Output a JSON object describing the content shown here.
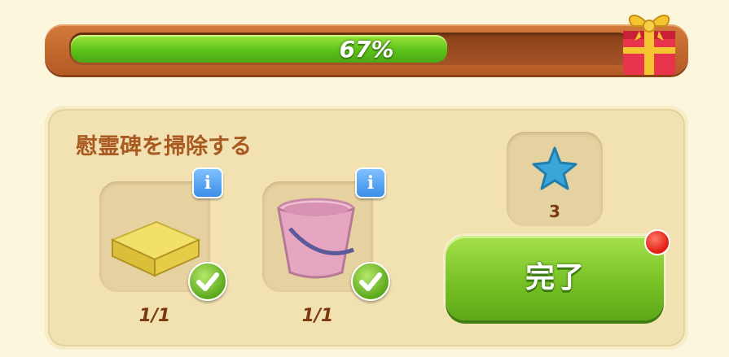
{
  "progress": {
    "percent_label": "67%",
    "fraction": 0.67
  },
  "task": {
    "title": "慰霊碑を掃除する",
    "items": [
      {
        "icon": "sponge-icon",
        "count": "1/1",
        "done": true
      },
      {
        "icon": "bucket-icon",
        "count": "1/1",
        "done": true
      }
    ],
    "reward": {
      "icon": "blue-star-icon",
      "count": "3"
    },
    "complete_label": "完了"
  },
  "colors": {
    "accent_green": "#74bf24",
    "frame_orange": "#c8682c",
    "info_blue": "#3b8ee6",
    "notify_red": "#e01a10"
  }
}
